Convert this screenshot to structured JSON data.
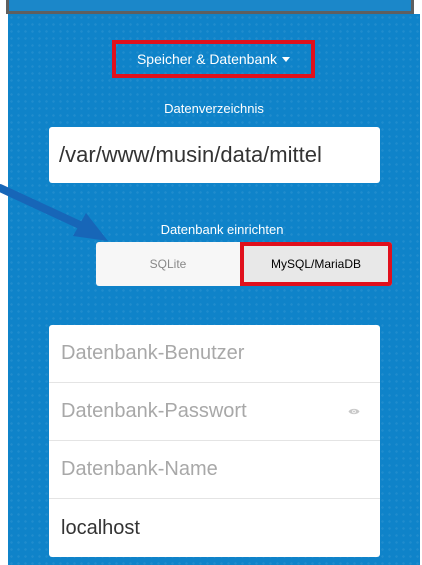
{
  "storage": {
    "toggle_label": "Speicher & Datenbank"
  },
  "data_directory": {
    "label": "Datenverzeichnis",
    "value": "/var/www/musin/data/mittel"
  },
  "database_setup": {
    "label": "Datenbank einrichten",
    "options": [
      "SQLite",
      "MySQL/MariaDB"
    ],
    "selected": "MySQL/MariaDB"
  },
  "db_form": {
    "user_placeholder": "Datenbank-Benutzer",
    "password_placeholder": "Datenbank-Passwort",
    "name_placeholder": "Datenbank-Name",
    "host_value": "localhost"
  },
  "colors": {
    "panel_blue": "#0f83c9",
    "highlight_red": "#e0101c",
    "arrow_blue": "#1766b8"
  },
  "icons": {
    "password_toggle": "eye-icon",
    "dropdown": "caret-down-icon",
    "annotation": "arrow-annotation"
  }
}
